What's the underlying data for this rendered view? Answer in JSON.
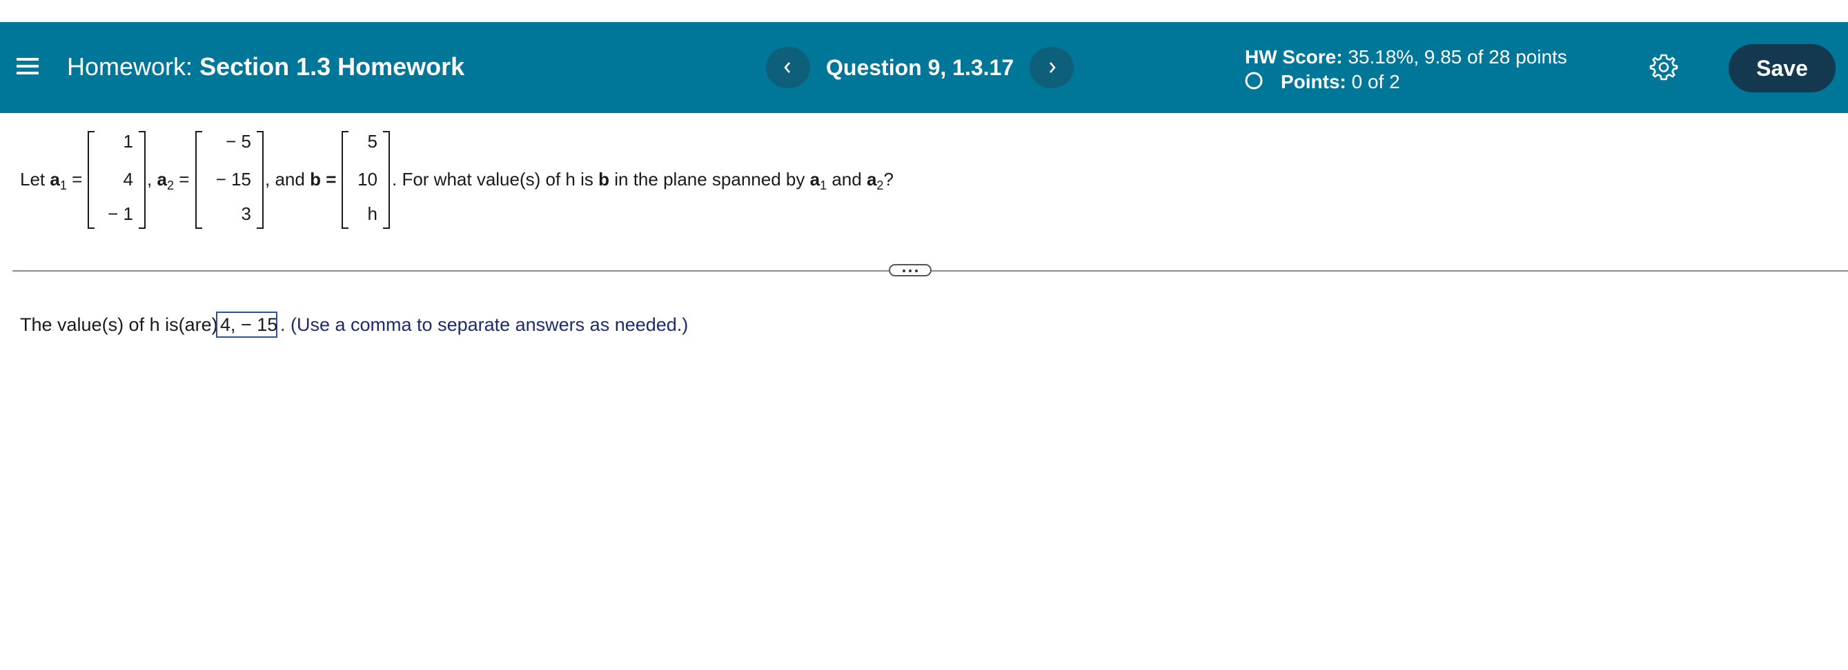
{
  "header": {
    "homework_prefix": "Homework:",
    "homework_title": "Section 1.3 Homework",
    "question_label": "Question 9, 1.3.17",
    "hw_score_label": "HW Score:",
    "hw_score_value": "35.18%, 9.85 of 28 points",
    "points_label": "Points:",
    "points_value": "0 of 2",
    "save_label": "Save",
    "colors": {
      "bar": "#007699",
      "save_button": "#14384f",
      "nav_button": "#0d5f7a"
    }
  },
  "question": {
    "let": "Let",
    "a1_name": "a",
    "a1_sub": "1",
    "eq": "=",
    "comma1": ",",
    "a2_name": "a",
    "a2_sub": "2",
    "and_b": ", and",
    "b_name": "b",
    "b_eq": "=",
    "prompt_start": ". For what value(s) of h is",
    "prompt_b": "b",
    "prompt_mid": "in the plane spanned by",
    "prompt_a": "a",
    "prompt_a1_sub": "1",
    "prompt_and": "and",
    "prompt_a2": "a",
    "prompt_a2_sub": "2",
    "prompt_end": "?",
    "a1": [
      "1",
      "4",
      "− 1"
    ],
    "a2": [
      "− 5",
      "− 15",
      "3"
    ],
    "b": [
      "5",
      "10",
      "h"
    ]
  },
  "answer": {
    "lead": "The value(s) of h is(are)",
    "value": "4, − 15",
    "hint": ". (Use a comma to separate answers as needed.)"
  }
}
